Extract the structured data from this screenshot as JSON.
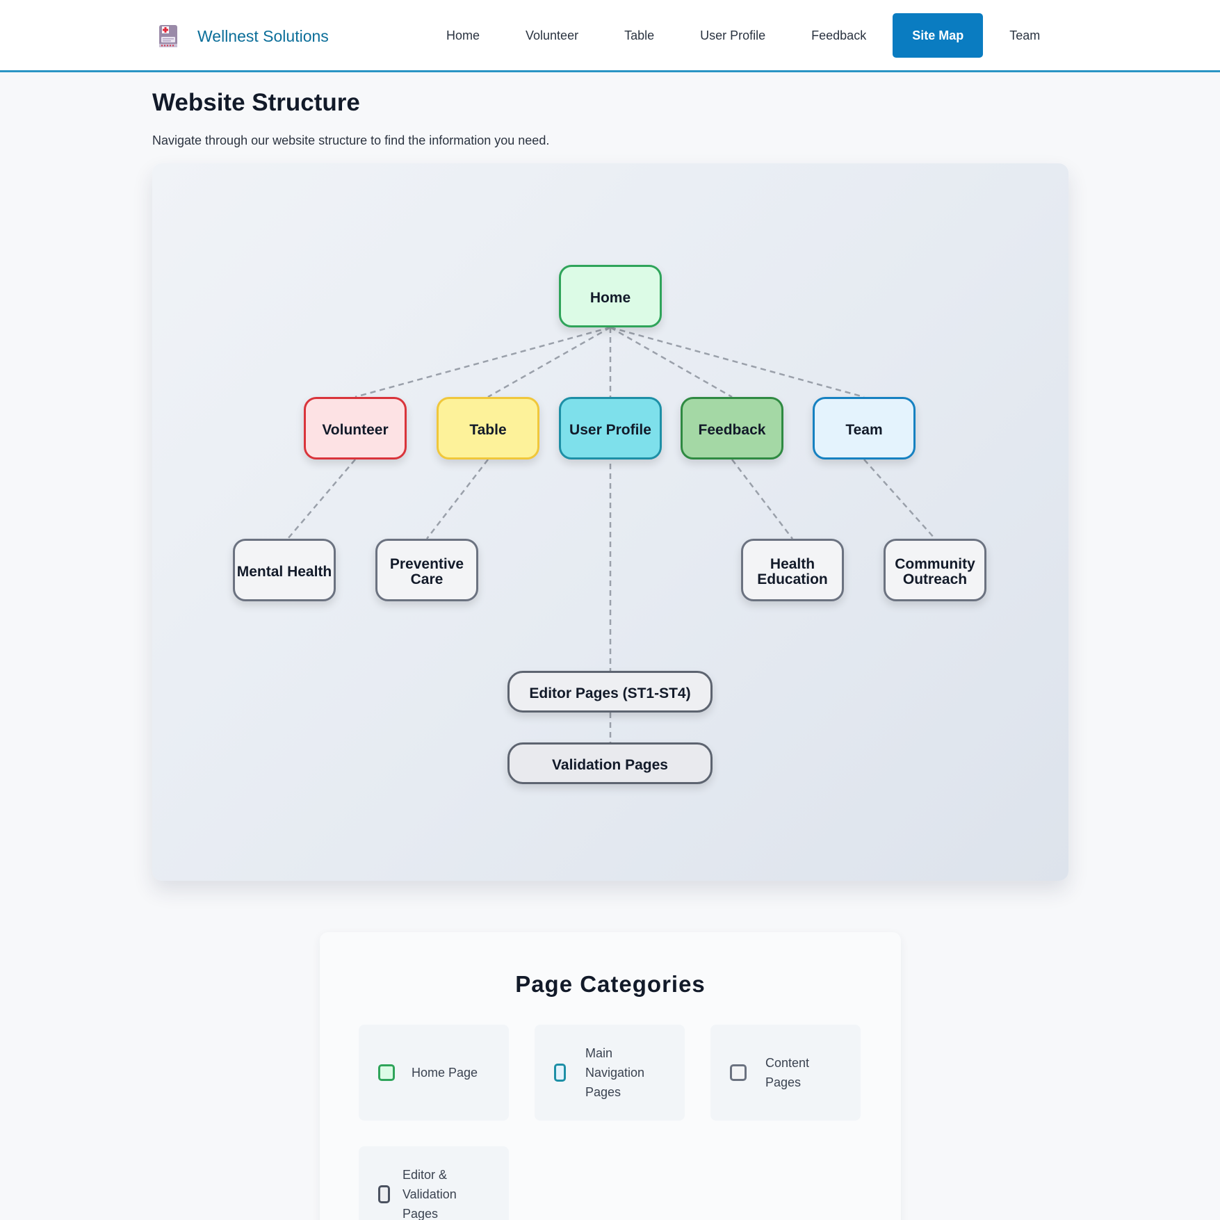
{
  "header": {
    "brand_name": "Wellnest Solutions",
    "logo_icon": "medical-document-icon",
    "nav": [
      {
        "label": "Home"
      },
      {
        "label": "Volunteer"
      },
      {
        "label": "Table"
      },
      {
        "label": "User Profile"
      },
      {
        "label": "Feedback"
      },
      {
        "label": "Site Map",
        "active": true
      },
      {
        "label": "Team"
      }
    ],
    "accent_color": "#0a7cc1"
  },
  "page": {
    "title": "Website Structure",
    "subtitle": "Navigate through our website structure to find the information you need."
  },
  "sitemap": {
    "nodes": {
      "home": "Home",
      "volunteer": "Volunteer",
      "table": "Table",
      "user_profile": "User Profile",
      "feedback": "Feedback",
      "team": "Team",
      "mental_health": "Mental Health",
      "preventive_care": "Preventive Care",
      "health_education": "Health Education",
      "community_outreach": "Community Outreach",
      "editor_pages": "Editor Pages (ST1-ST4)",
      "validation_pages": "Validation Pages"
    },
    "edges": [
      [
        "home",
        "volunteer"
      ],
      [
        "home",
        "table"
      ],
      [
        "home",
        "user_profile"
      ],
      [
        "home",
        "feedback"
      ],
      [
        "home",
        "team"
      ],
      [
        "volunteer",
        "mental_health"
      ],
      [
        "table",
        "preventive_care"
      ],
      [
        "feedback",
        "health_education"
      ],
      [
        "team",
        "community_outreach"
      ],
      [
        "home",
        "editor_pages"
      ],
      [
        "editor_pages",
        "validation_pages"
      ]
    ],
    "colors": {
      "home": "#2fa45a",
      "volunteer": "#d9343b",
      "table": "#f0c73b",
      "user_profile": "#1d8fa6",
      "feedback": "#2f8a42",
      "team": "#1681c1",
      "content": "#6b7280"
    }
  },
  "categories": {
    "title": "Page Categories",
    "items": [
      {
        "label": "Home Page"
      },
      {
        "label": "Main Navigation Pages"
      },
      {
        "label": "Content Pages"
      },
      {
        "label": "Editor & Validation Pages"
      }
    ]
  }
}
